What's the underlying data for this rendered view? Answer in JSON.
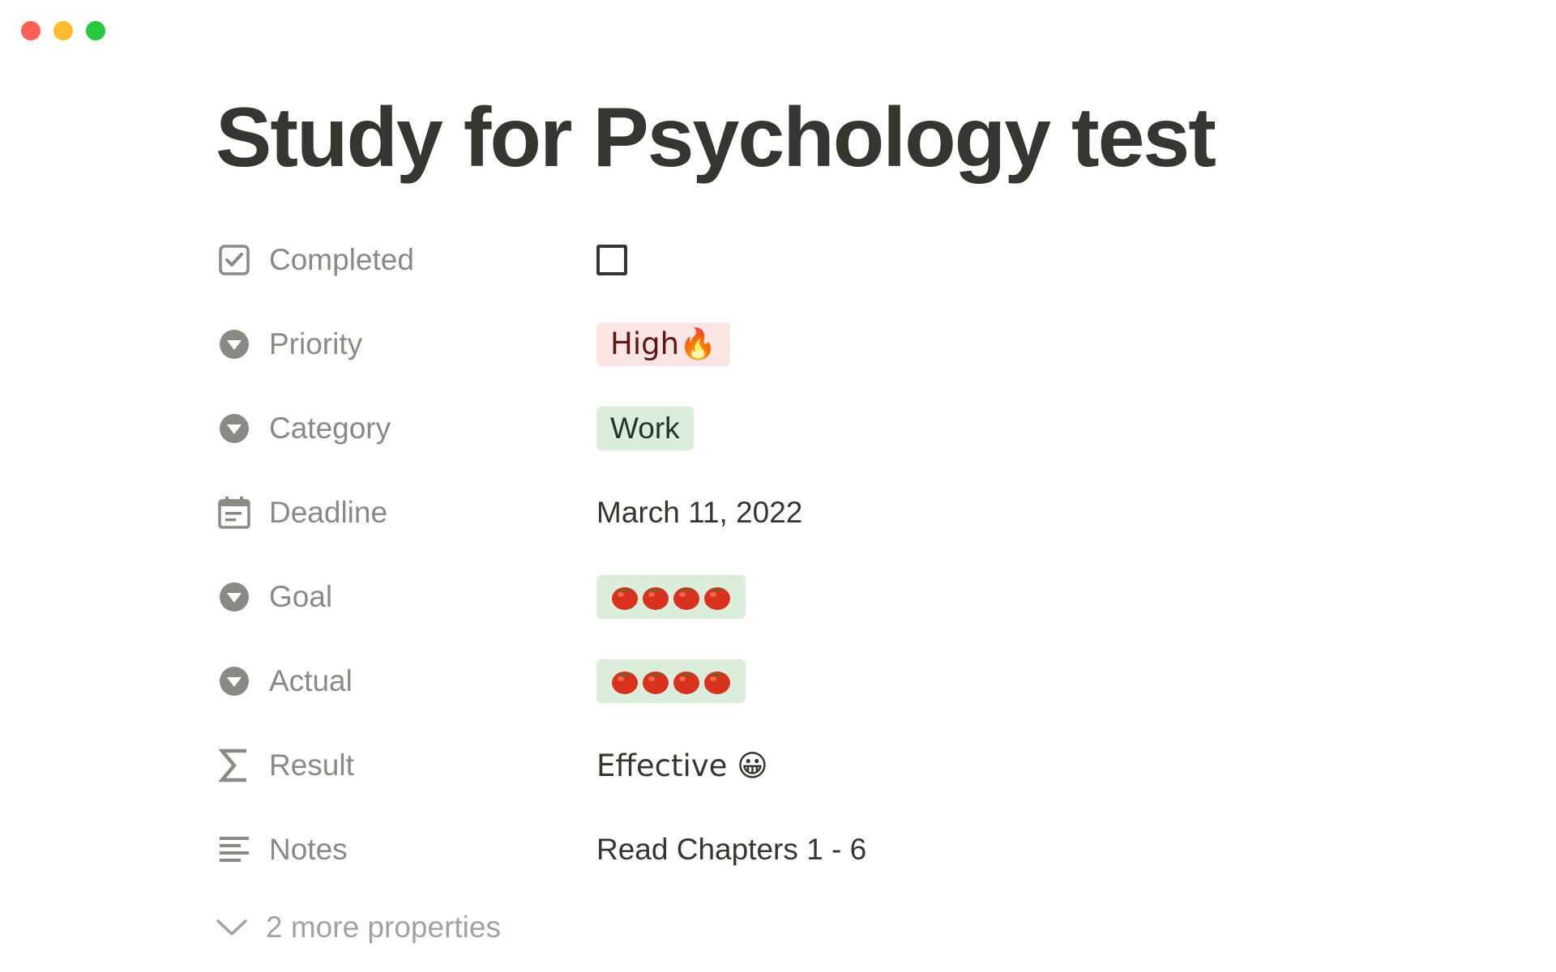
{
  "page": {
    "title": "Study for Psychology test"
  },
  "properties": [
    {
      "key": "Completed",
      "icon": "checkbox-property-icon",
      "type": "checkbox",
      "checked": false
    },
    {
      "key": "Priority",
      "icon": "select-property-icon",
      "type": "tag",
      "value": "High🔥",
      "color": "#fbe4e4"
    },
    {
      "key": "Category",
      "icon": "select-property-icon",
      "type": "tag",
      "value": "Work",
      "color": "#dbeddb"
    },
    {
      "key": "Deadline",
      "icon": "calendar-property-icon",
      "type": "date",
      "value": "March 11, 2022"
    },
    {
      "key": "Goal",
      "icon": "select-property-icon",
      "type": "tag",
      "value": "🍅🍅🍅🍅",
      "count": 4,
      "color": "#dbeddb"
    },
    {
      "key": "Actual",
      "icon": "select-property-icon",
      "type": "tag",
      "value": "🍅🍅🍅🍅",
      "count": 4,
      "color": "#dbeddb"
    },
    {
      "key": "Result",
      "icon": "formula-sigma-icon",
      "type": "formula",
      "value": "Effective 😀"
    },
    {
      "key": "Notes",
      "icon": "text-lines-icon",
      "type": "text",
      "value": "Read Chapters 1 - 6"
    }
  ],
  "more_properties": {
    "label": "2 more properties",
    "icon": "chevron-down-icon"
  },
  "colors": {
    "title": "#37352f",
    "label": "#8a8984",
    "tag_red_bg": "#fbe4e4",
    "tag_green_bg": "#dbeddb"
  }
}
